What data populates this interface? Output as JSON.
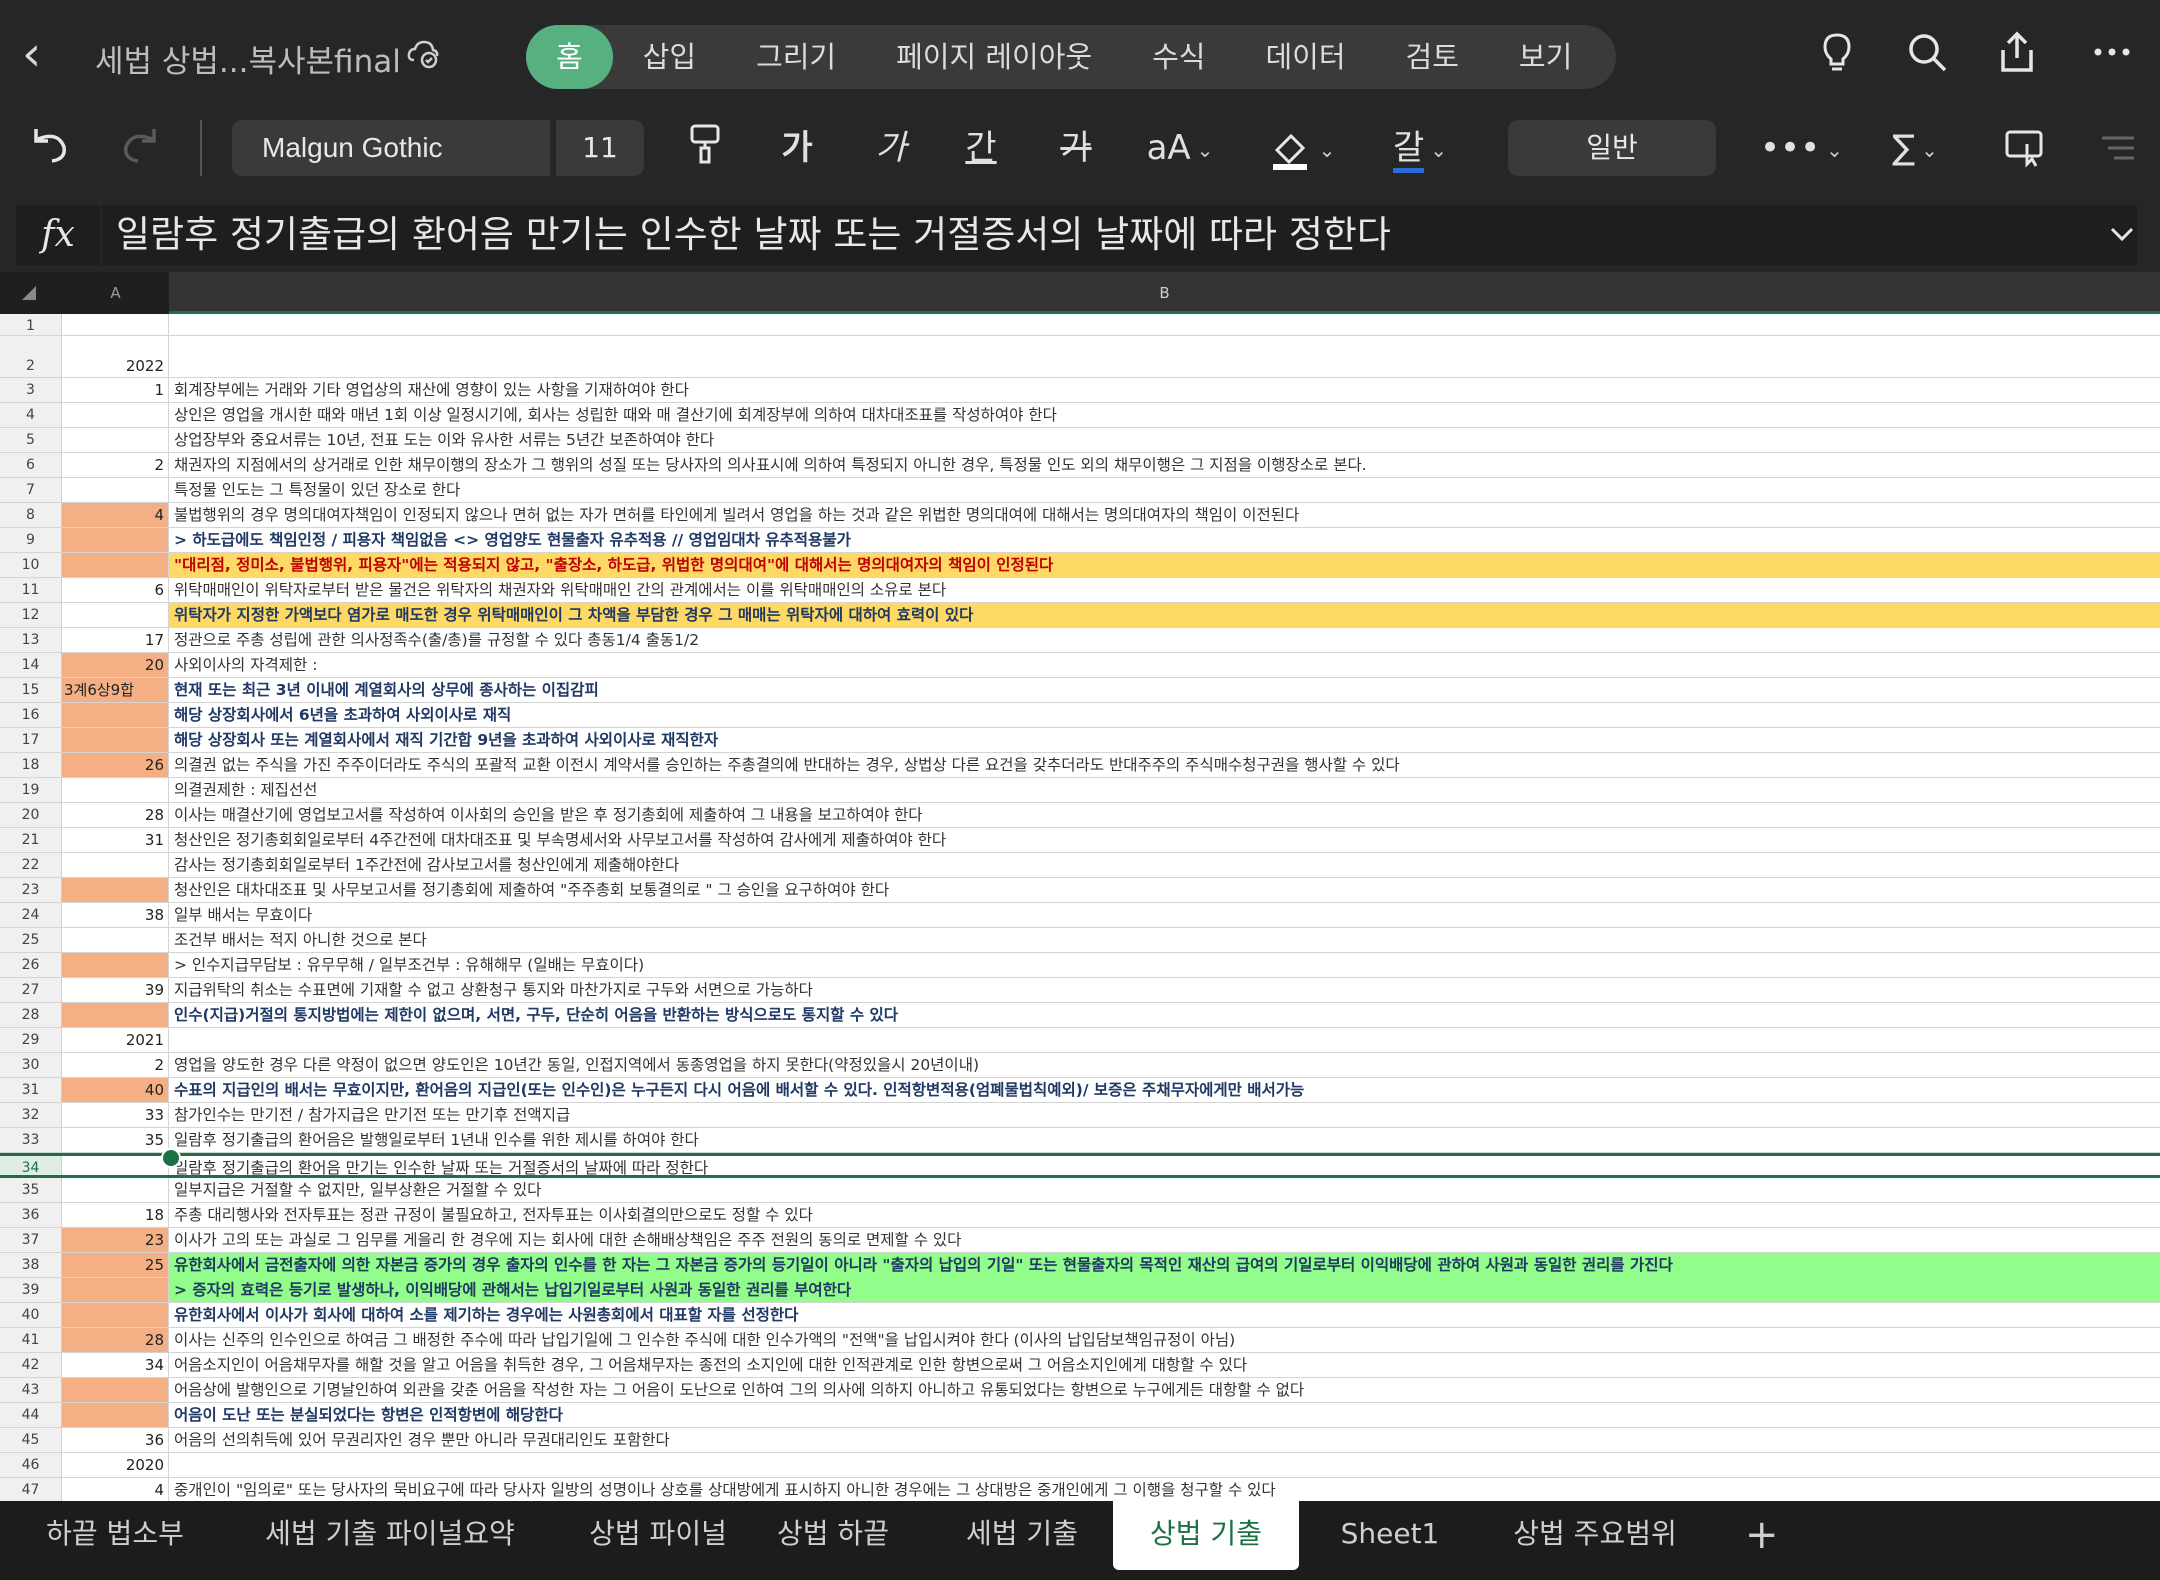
{
  "app": {
    "doc_title": "세법 상법...복사본final",
    "ribbon_tabs": [
      "홈",
      "삽입",
      "그리기",
      "페이지 레이아웃",
      "수식",
      "데이터",
      "검토",
      "보기"
    ],
    "active_tab": "홈"
  },
  "toolbar": {
    "font_name": "Malgun Gothic",
    "font_size": "11",
    "bold_label": "가",
    "italic_label": "가",
    "underline_label": "간",
    "strike_label": "가",
    "text_size_label": "aA",
    "font_color_label": "갈",
    "number_format": "일반"
  },
  "formula_bar": {
    "fx_label": "fx",
    "content": "일람후 정기출급의 환어음 만기는 인수한 날짜 또는 거절증서의 날짜에 따라 정한다"
  },
  "grid": {
    "col_a": "A",
    "col_b": "B",
    "rows": [
      {
        "n": "1",
        "a": "",
        "b": "",
        "fa": "",
        "fb": ""
      },
      {
        "n": "2",
        "a": "2022",
        "b": "",
        "fa": "",
        "fb": ""
      },
      {
        "n": "3",
        "a": "1",
        "b": "회계장부에는 거래와 기타 영업상의 재산에 영향이 있는 사항을 기재하여야 한다",
        "fa": "",
        "fb": ""
      },
      {
        "n": "4",
        "a": "",
        "b": "상인은 영업을 개시한 때와 매년 1회 이상 일정시기에, 회사는 성립한 때와 매 결산기에 회계장부에 의하여 대차대조표를 작성하여야 한다",
        "fa": "",
        "fb": ""
      },
      {
        "n": "5",
        "a": "",
        "b": "상업장부와 중요서류는 10년, 전표 도는 이와 유사한 서류는 5년간 보존하여야 한다",
        "fa": "",
        "fb": ""
      },
      {
        "n": "6",
        "a": "2",
        "b": "채권자의 지점에서의 상거래로 인한 채무이행의 장소가 그 행위의 성질 또는 당사자의 의사표시에 의하여 특정되지 아니한 경우, 특정물 인도 외의 채무이행은 그 지점을 이행장소로 본다.",
        "fa": "",
        "fb": ""
      },
      {
        "n": "7",
        "a": "",
        "b": "특정물 인도는 그 특정물이 있던 장소로 한다",
        "fa": "",
        "fb": ""
      },
      {
        "n": "8",
        "a": "4",
        "b": "불법행위의 경우 명의대여자책임이 인정되지 않으나 면허 없는 자가 면허를 타인에게 빌려서 영업을 하는 것과 같은 위법한 명의대여에 대해서는 명의대여자의 책임이 이전된다",
        "fa": "peach",
        "fb": ""
      },
      {
        "n": "9",
        "a": "",
        "b": "> 하도급에도 책임인정 / 피용자 책임없음 <> 영업양도 현물출자 유추적용 // 영업임대차 유추적용불가",
        "fa": "peach",
        "fb": "bold"
      },
      {
        "n": "10",
        "a": "",
        "b": "\"대리점, 정미소, 불법행위, 피용자\"에는 적용되지 않고, \"출장소, 하도급, 위법한 명의대여\"에 대해서는 명의대여자의 책임이 인정된다",
        "fa": "peach",
        "fb": "yellow red"
      },
      {
        "n": "11",
        "a": "6",
        "b": "위탁매매인이 위탁자로부터 받은 물건은 위탁자의 채권자와 위탁매매인 간의 관계에서는 이를 위탁매매인의 소유로 본다",
        "fa": "",
        "fb": ""
      },
      {
        "n": "12",
        "a": "",
        "b": "위탁자가 지정한 가액보다 염가로 매도한 경우 위탁매매인이 그 차액을 부담한 경우 그 매매는 위탁자에 대하여 효력이 있다",
        "fa": "",
        "fb": "yellow bold"
      },
      {
        "n": "13",
        "a": "17",
        "b": "정관으로 주총 성립에 관한 의사정족수(출/총)를 규정할 수 있다 총동1/4 출동1/2",
        "fa": "",
        "fb": ""
      },
      {
        "n": "14",
        "a": "20",
        "b": "사외이사의 자격제한 :",
        "fa": "peach",
        "fb": ""
      },
      {
        "n": "15",
        "a": "3계6상9합",
        "b": "현재 또는 최근 3년 이내에 계열회사의 상무에 종사하는 이집감피",
        "fa": "peach left",
        "fb": "bold"
      },
      {
        "n": "16",
        "a": "",
        "b": "해당 상장회사에서 6년을 초과하여 사외이사로 재직",
        "fa": "peach",
        "fb": "bold"
      },
      {
        "n": "17",
        "a": "",
        "b": "해당 상장회사 또는 계열회사에서 재직 기간합 9년을 초과하여 사외이사로 재직한자",
        "fa": "peach",
        "fb": "bold"
      },
      {
        "n": "18",
        "a": "26",
        "b": "의결권 없는 주식을 가진 주주이더라도 주식의 포괄적 교환 이전시 계약서를 승인하는 주총결의에 반대하는 경우, 상법상 다른 요건을 갖추더라도 반대주주의 주식매수청구권을 행사할 수 있다",
        "fa": "peach",
        "fb": ""
      },
      {
        "n": "19",
        "a": "",
        "b": "의결권제한 : 제집선선",
        "fa": "",
        "fb": ""
      },
      {
        "n": "20",
        "a": "28",
        "b": "이사는 매결산기에 영업보고서를 작성하여 이사회의 승인을 받은 후 정기총회에 제출하여 그 내용을 보고하여야 한다",
        "fa": "",
        "fb": ""
      },
      {
        "n": "21",
        "a": "31",
        "b": "청산인은 정기총회회일로부터 4주간전에 대차대조표 및 부속명세서와 사무보고서를 작성하여 감사에게 제출하여야 한다",
        "fa": "",
        "fb": ""
      },
      {
        "n": "22",
        "a": "",
        "b": "감사는 정기총회회일로부터 1주간전에 감사보고서를 청산인에게 제출해야한다",
        "fa": "",
        "fb": ""
      },
      {
        "n": "23",
        "a": "",
        "b": "청산인은 대차대조표 및 사무보고서를 정기총회에 제출하여 \"주주총회 보통결의로 \" 그 승인을 요구하여야 한다",
        "fa": "peach",
        "fb": ""
      },
      {
        "n": "24",
        "a": "38",
        "b": "일부 배서는 무효이다",
        "fa": "",
        "fb": ""
      },
      {
        "n": "25",
        "a": "",
        "b": "조건부 배서는 적지 아니한 것으로 본다",
        "fa": "",
        "fb": ""
      },
      {
        "n": "26",
        "a": "",
        "b": "> 인수지급무담보 : 유무무해 / 일부조건부 : 유해해무 (일배는 무효이다)",
        "fa": "peach",
        "fb": ""
      },
      {
        "n": "27",
        "a": "39",
        "b": "지급위탁의 취소는 수표면에 기재할 수 없고 상환청구 통지와 마찬가지로 구두와 서면으로 가능하다",
        "fa": "",
        "fb": ""
      },
      {
        "n": "28",
        "a": "",
        "b": "인수(지급)거절의 통지방법에는 제한이 없으며, 서면, 구두, 단순히 어음을 반환하는 방식으로도 통지할 수 있다",
        "fa": "peach",
        "fb": "bold"
      },
      {
        "n": "29",
        "a": "2021",
        "b": "",
        "fa": "",
        "fb": ""
      },
      {
        "n": "30",
        "a": "2",
        "b": "영업을 양도한 경우 다른 약정이 없으면 양도인은 10년간 동일, 인접지역에서 동종영업을 하지 못한다(약정있을시 20년이내)",
        "fa": "",
        "fb": ""
      },
      {
        "n": "31",
        "a": "40",
        "b": "수표의 지급인의 배서는 무효이지만, 환어음의 지급인(또는 인수인)은 누구든지 다시 어음에 배서할 수 있다. 인적항변적용(엄폐물법칙예외)/ 보증은 주채무자에게만 배서가능",
        "fa": "peach",
        "fb": "bold"
      },
      {
        "n": "32",
        "a": "33",
        "b": "참가인수는 만기전 / 참가지급은 만기전 또는 만기후 전액지급",
        "fa": "",
        "fb": ""
      },
      {
        "n": "33",
        "a": "35",
        "b": "일람후 정기출급의 환어음은 발행일로부터 1년내 인수를 위한 제시를 하여야 한다",
        "fa": "",
        "fb": ""
      },
      {
        "n": "34",
        "a": "",
        "b": "일람후 정기출급의 환어음 만기는 인수한 날짜 또는 거절증서의 날짜에 따라 정한다",
        "fa": "",
        "fb": ""
      },
      {
        "n": "35",
        "a": "",
        "b": "일부지급은 거절할 수 없지만, 일부상환은 거절할 수 있다",
        "fa": "",
        "fb": ""
      },
      {
        "n": "36",
        "a": "18",
        "b": "주총 대리행사와 전자투표는 정관 규정이 불필요하고, 전자투표는 이사회결의만으로도 정할 수 있다",
        "fa": "",
        "fb": ""
      },
      {
        "n": "37",
        "a": "23",
        "b": "이사가 고의 또는 과실로 그 임무를 게을리 한 경우에 지는 회사에 대한 손해배상책임은 주주 전원의 동의로 면제할 수 있다",
        "fa": "peach",
        "fb": ""
      },
      {
        "n": "38",
        "a": "25",
        "b": "유한회사에서 금전출자에 의한 자본금 증가의 경우 출자의 인수를 한 자는 그 자본금 증가의 등기일이 아니라 \"출자의 납입의 기일\" 또는 현물출자의 목적인 재산의 급여의 기일로부터 이익배당에 관하여 사원과 동일한 권리를 가진다",
        "fa": "peach",
        "fb": "green bold"
      },
      {
        "n": "39",
        "a": "",
        "b": "> 증자의 효력은 등기로 발생하나, 이익배당에 관해서는 납입기일로부터 사원과 동일한 권리를 부여한다",
        "fa": "peach",
        "fb": "green bold"
      },
      {
        "n": "40",
        "a": "",
        "b": "유한회사에서 이사가 회사에 대하여 소를 제기하는 경우에는 사원총회에서 대표할 자를 선정한다",
        "fa": "peach",
        "fb": "bold"
      },
      {
        "n": "41",
        "a": "28",
        "b": "이사는 신주의 인수인으로 하여금 그 배정한 주수에 따라 납입기일에 그 인수한 주식에 대한 인수가액의 \"전액\"을 납입시켜야 한다 (이사의 납입담보책임규정이 아님)",
        "fa": "peach",
        "fb": ""
      },
      {
        "n": "42",
        "a": "34",
        "b": "어음소지인이 어음채무자를 해할 것을 알고 어음을 취득한 경우, 그 어음채무자는 종전의 소지인에 대한 인적관계로 인한 항변으로써 그 어음소지인에게 대항할 수 있다",
        "fa": "",
        "fb": ""
      },
      {
        "n": "43",
        "a": "",
        "b": "어음상에 발행인으로 기명날인하여 외관을 갖춘 어음을 작성한 자는 그 어음이 도난으로 인하여 그의 의사에 의하지 아니하고 유통되었다는 항변으로 누구에게든 대항할 수 없다",
        "fa": "peach",
        "fb": ""
      },
      {
        "n": "44",
        "a": "",
        "b": "어음이 도난 또는 분실되었다는 항변은 인적항변에 해당한다",
        "fa": "peach",
        "fb": "bold"
      },
      {
        "n": "45",
        "a": "36",
        "b": "어음의 선의취득에 있어 무권리자인 경우 뿐만 아니라 무권대리인도 포함한다",
        "fa": "",
        "fb": ""
      },
      {
        "n": "46",
        "a": "2020",
        "b": "",
        "fa": "",
        "fb": ""
      },
      {
        "n": "47",
        "a": "4",
        "b": "중개인이 \"임의로\" 또는 당사자의 묵비요구에 따라 당사자 일방의 성명이나 상호를 상대방에게 표시하지 아니한 경우에는 그 상대방은 중개인에게 그 이행을 청구할 수 있다",
        "fa": "",
        "fb": ""
      }
    ]
  },
  "sheet_tabs": [
    "하끝 법소부",
    "세법 기출 파이널요약",
    "상법 파이널",
    "상법 하끝",
    "세법 기출",
    "상법 기출",
    "Sheet1",
    "상법 주요범위"
  ],
  "active_sheet": "상법 기출",
  "colors": {
    "accent": "#1e7145",
    "peach": "#f4b084",
    "yellow": "#ffd966",
    "green": "#92fd8a"
  }
}
